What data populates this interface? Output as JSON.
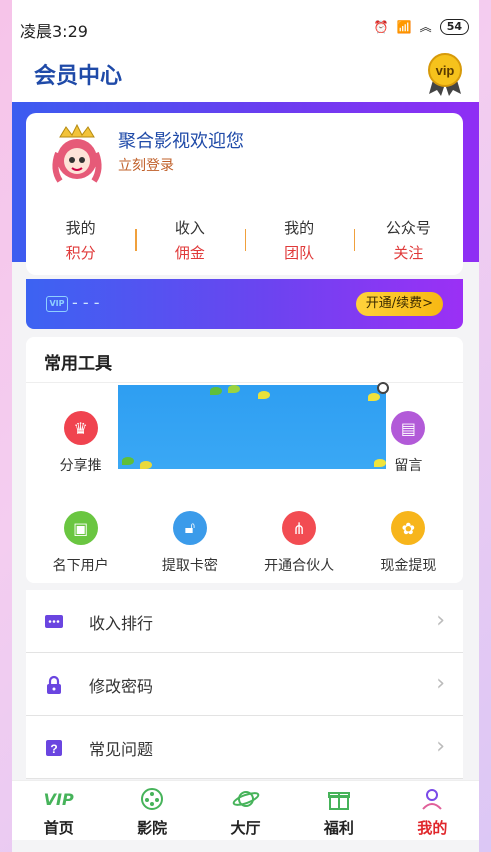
{
  "status_bar": {
    "time": "凌晨3:29",
    "battery": "54"
  },
  "header": {
    "title": "会员中心",
    "badge_text": "vip"
  },
  "profile": {
    "welcome": "聚合影视欢迎您",
    "login": "立刻登录"
  },
  "stats": [
    {
      "line1": "我的",
      "line2": "积分"
    },
    {
      "line1": "收入",
      "line2": "佣金"
    },
    {
      "line1": "我的",
      "line2": "团队"
    },
    {
      "line1": "公众号",
      "line2": "关注"
    }
  ],
  "vip_strip": {
    "icon_text": "VIP",
    "status": "- - -",
    "button": "开通/续费>"
  },
  "tools": {
    "title": "常用工具",
    "row1": [
      {
        "label": "分享推",
        "icon": "crown-icon",
        "color": "#f0434f"
      },
      {
        "label": "",
        "icon": "",
        "color": ""
      },
      {
        "label": "",
        "icon": "",
        "color": ""
      },
      {
        "label": "留言",
        "icon": "store-icon",
        "color": "#b25ad8"
      }
    ],
    "row2": [
      {
        "label": "名下用户",
        "icon": "user-card-icon",
        "color": "#6ac641"
      },
      {
        "label": "提取卡密",
        "icon": "lock-icon",
        "color": "#3b9bea"
      },
      {
        "label": "开通合伙人",
        "icon": "network-icon",
        "color": "#f24c52"
      },
      {
        "label": "现金提现",
        "icon": "gear-icon",
        "color": "#f7b51b"
      }
    ]
  },
  "menu": [
    {
      "label": "收入排行",
      "icon": "chat-icon",
      "color": "#6a45e0"
    },
    {
      "label": "修改密码",
      "icon": "lock-icon",
      "color": "#6a45e0"
    },
    {
      "label": "常见问题",
      "icon": "question-icon",
      "color": "#6a45e0"
    }
  ],
  "bottom_nav": [
    {
      "label": "首页",
      "icon": "vip-logo-icon"
    },
    {
      "label": "影院",
      "icon": "film-reel-icon"
    },
    {
      "label": "大厅",
      "icon": "planet-icon"
    },
    {
      "label": "福利",
      "icon": "gift-icon"
    },
    {
      "label": "我的",
      "icon": "user-icon",
      "active": true
    }
  ]
}
